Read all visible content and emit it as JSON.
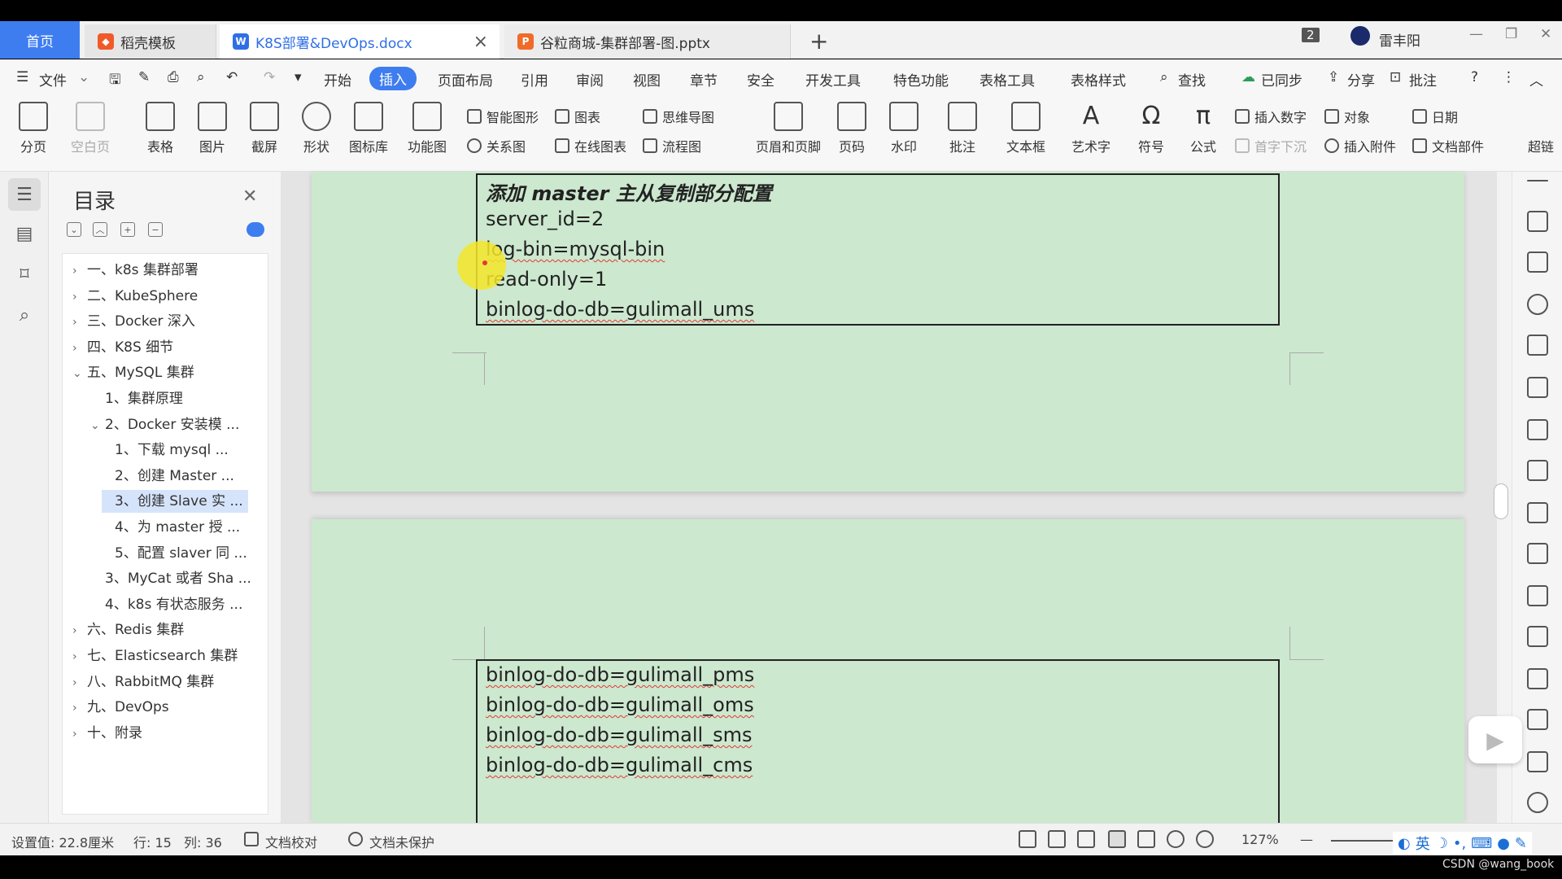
{
  "tabs": {
    "home": "首页",
    "template": "稻壳模板",
    "doc": "K8S部署&DevOps.docx",
    "ppt": "谷粒商城-集群部署-图.pptx",
    "new_tab": "+"
  },
  "titlebar": {
    "window_count": "2",
    "user": "雷丰阳",
    "minimize": "—",
    "restore": "❐",
    "close": "✕"
  },
  "menu": {
    "file": "文件",
    "items": [
      "开始",
      "插入",
      "页面布局",
      "引用",
      "审阅",
      "视图",
      "章节",
      "安全",
      "开发工具",
      "特色功能",
      "表格工具",
      "表格样式"
    ],
    "search": "查找",
    "sync": "已同步",
    "share": "分享",
    "comment": "批注",
    "help": "?"
  },
  "ribbon": {
    "big": [
      "分页",
      "空白页",
      "表格",
      "图片",
      "截屏",
      "形状",
      "图标库",
      "功能图"
    ],
    "small_col1": [
      "智能图形",
      "关系图"
    ],
    "small_col2": [
      "图表",
      "在线图表"
    ],
    "small_col3": [
      "思维导图",
      "流程图"
    ],
    "big2": [
      "页眉和页脚",
      "页码",
      "水印",
      "批注",
      "文本框",
      "艺术字",
      "符号",
      "公式"
    ],
    "small_col4": [
      "插入数字",
      "首字下沉"
    ],
    "small_col5": [
      "对象",
      "插入附件"
    ],
    "small_col6": [
      "日期",
      "文档部件"
    ],
    "more": "超链"
  },
  "toc": {
    "title": "目录",
    "items": [
      {
        "label": "一、k8s 集群部署",
        "level": 0,
        "arrow": "›"
      },
      {
        "label": "二、KubeSphere",
        "level": 0,
        "arrow": "›"
      },
      {
        "label": "三、Docker 深入",
        "level": 0,
        "arrow": "›"
      },
      {
        "label": "四、K8S 细节",
        "level": 0,
        "arrow": "›"
      },
      {
        "label": "五、MySQL 集群",
        "level": 0,
        "arrow": "⌄"
      },
      {
        "label": "1、集群原理",
        "level": 1,
        "arrow": ""
      },
      {
        "label": "2、Docker 安装模 ...",
        "level": 1,
        "arrow": "⌄"
      },
      {
        "label": "1、下载 mysql ...",
        "level": 2,
        "arrow": ""
      },
      {
        "label": "2、创建 Master ...",
        "level": 2,
        "arrow": ""
      },
      {
        "label": "3、创建 Slave 实 ...",
        "level": 2,
        "arrow": ""
      },
      {
        "label": "4、为 master 授 ...",
        "level": 2,
        "arrow": ""
      },
      {
        "label": "5、配置 slaver 同 ...",
        "level": 2,
        "arrow": ""
      },
      {
        "label": "3、MyCat 或者 Sha ...",
        "level": 1,
        "arrow": ""
      },
      {
        "label": "4、k8s 有状态服务 ...",
        "level": 1,
        "arrow": ""
      },
      {
        "label": "六、Redis 集群",
        "level": 0,
        "arrow": "›"
      },
      {
        "label": "七、Elasticsearch 集群",
        "level": 0,
        "arrow": "›"
      },
      {
        "label": "八、RabbitMQ 集群",
        "level": 0,
        "arrow": "›"
      },
      {
        "label": "九、DevOps",
        "level": 0,
        "arrow": "›"
      },
      {
        "label": "十、附录",
        "level": 0,
        "arrow": "›"
      }
    ],
    "selected_index": 9
  },
  "document": {
    "page1_lines": [
      "添加 master 主从复制部分配置",
      "server_id=2",
      "log-bin=mysql-bin",
      "read-only=1",
      "binlog-do-db=gulimall_ums"
    ],
    "page2_lines": [
      "binlog-do-db=gulimall_pms",
      "binlog-do-db=gulimall_oms",
      "binlog-do-db=gulimall_sms",
      "binlog-do-db=gulimall_cms"
    ]
  },
  "status": {
    "setting": "设置值: 22.8厘米",
    "row": "行: 15",
    "col": "列: 36",
    "proof": "文档校对",
    "protect": "文档未保护",
    "zoom": "127%",
    "zoom_minus": "—"
  },
  "ime": {
    "lang": "英"
  },
  "watermark": "CSDN @wang_book"
}
